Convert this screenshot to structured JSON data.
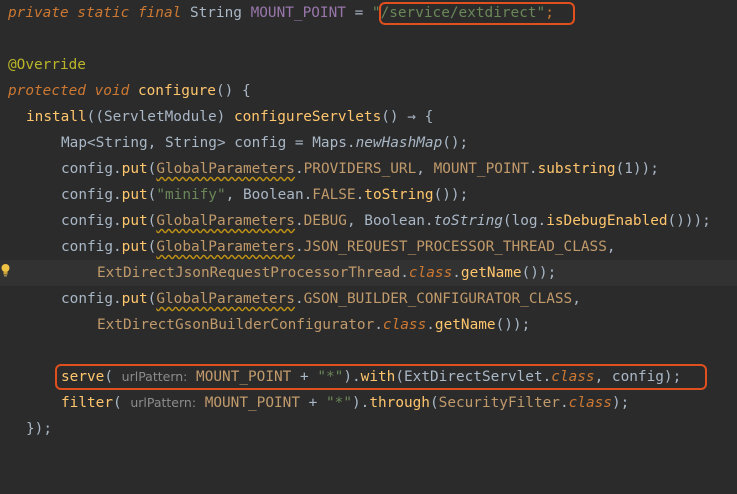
{
  "lines": [
    {
      "id": "l1",
      "tokens": [
        {
          "t": "private static final",
          "c": "kw"
        },
        {
          "t": " String ",
          "c": "type"
        },
        {
          "t": "MOUNT_POINT",
          "c": "const"
        },
        {
          "t": " = ",
          "c": "type"
        },
        {
          "t": "\"/service/extdirect\"",
          "c": "str"
        },
        {
          "t": ";",
          "c": "kwn"
        }
      ]
    },
    {
      "id": "l2",
      "tokens": []
    },
    {
      "id": "l3",
      "tokens": [
        {
          "t": "@Override",
          "c": "ann"
        }
      ]
    },
    {
      "id": "l4",
      "tokens": [
        {
          "t": "protected void",
          "c": "kw"
        },
        {
          "t": " ",
          "c": "type"
        },
        {
          "t": "configure",
          "c": "fn"
        },
        {
          "t": "() {",
          "c": "type"
        }
      ]
    },
    {
      "id": "l5",
      "tokens": [
        {
          "t": "install",
          "c": "fn"
        },
        {
          "t": "((ServletModule) ",
          "c": "type"
        },
        {
          "t": "configureServlets",
          "c": "fn"
        },
        {
          "t": "() → {",
          "c": "type"
        }
      ]
    },
    {
      "id": "l6",
      "tokens": [
        {
          "t": "Map",
          "c": "type"
        },
        {
          "t": "<String, String> config = Maps.",
          "c": "type"
        },
        {
          "t": "newHashMap",
          "c": "static"
        },
        {
          "t": "();",
          "c": "type"
        }
      ]
    },
    {
      "id": "l7",
      "tokens": [
        {
          "t": "config.",
          "c": "type"
        },
        {
          "t": "put",
          "c": "fn"
        },
        {
          "t": "(",
          "c": "type"
        },
        {
          "t": "GlobalParameters",
          "c": "warnc"
        },
        {
          "t": ".",
          "c": "type"
        },
        {
          "t": "PROVIDERS_URL",
          "c": "member"
        },
        {
          "t": ", ",
          "c": "type"
        },
        {
          "t": "MOUNT_POINT",
          "c": "member"
        },
        {
          "t": ".",
          "c": "type"
        },
        {
          "t": "substring",
          "c": "fn"
        },
        {
          "t": "(1));",
          "c": "type"
        }
      ]
    },
    {
      "id": "l8",
      "tokens": [
        {
          "t": "config.",
          "c": "type"
        },
        {
          "t": "put",
          "c": "fn"
        },
        {
          "t": "(",
          "c": "type"
        },
        {
          "t": "\"minify\"",
          "c": "str"
        },
        {
          "t": ", Boolean.",
          "c": "type"
        },
        {
          "t": "FALSE",
          "c": "member"
        },
        {
          "t": ".",
          "c": "type"
        },
        {
          "t": "toString",
          "c": "fn"
        },
        {
          "t": "());",
          "c": "type"
        }
      ]
    },
    {
      "id": "l9",
      "tokens": [
        {
          "t": "config.",
          "c": "type"
        },
        {
          "t": "put",
          "c": "fn"
        },
        {
          "t": "(",
          "c": "type"
        },
        {
          "t": "GlobalParameters",
          "c": "warnc"
        },
        {
          "t": ".",
          "c": "type"
        },
        {
          "t": "DEBUG",
          "c": "member"
        },
        {
          "t": ", Boolean.",
          "c": "type"
        },
        {
          "t": "toString",
          "c": "static"
        },
        {
          "t": "(log.",
          "c": "type"
        },
        {
          "t": "isDebugEnabled",
          "c": "fn"
        },
        {
          "t": "()));",
          "c": "type"
        }
      ]
    },
    {
      "id": "l10",
      "tokens": [
        {
          "t": "config.",
          "c": "type"
        },
        {
          "t": "put",
          "c": "fn"
        },
        {
          "t": "(",
          "c": "type"
        },
        {
          "t": "GlobalParameters",
          "c": "warnc"
        },
        {
          "t": ".",
          "c": "type"
        },
        {
          "t": "JSON_REQUEST_PROCESSOR_THREAD_CLASS",
          "c": "member"
        },
        {
          "t": ",",
          "c": "type"
        }
      ]
    },
    {
      "id": "l11",
      "tokens": [
        {
          "t": "ExtDirectJsonRequestProcessorThread",
          "c": "member"
        },
        {
          "t": ".",
          "c": "type"
        },
        {
          "t": "class",
          "c": "kw"
        },
        {
          "t": ".",
          "c": "type"
        },
        {
          "t": "getName",
          "c": "fn"
        },
        {
          "t": "());",
          "c": "type"
        }
      ]
    },
    {
      "id": "l12",
      "tokens": [
        {
          "t": "config.",
          "c": "type"
        },
        {
          "t": "put",
          "c": "fn"
        },
        {
          "t": "(",
          "c": "type"
        },
        {
          "t": "GlobalParameters",
          "c": "warnc"
        },
        {
          "t": ".",
          "c": "type"
        },
        {
          "t": "GSON_BUILDER_CONFIGURATOR_CLASS",
          "c": "member"
        },
        {
          "t": ",",
          "c": "type"
        }
      ]
    },
    {
      "id": "l13",
      "tokens": [
        {
          "t": "ExtDirectGsonBuilderConfigurator",
          "c": "member"
        },
        {
          "t": ".",
          "c": "type"
        },
        {
          "t": "class",
          "c": "kw"
        },
        {
          "t": ".",
          "c": "type"
        },
        {
          "t": "getName",
          "c": "fn"
        },
        {
          "t": "());",
          "c": "type"
        }
      ]
    },
    {
      "id": "l14",
      "tokens": []
    },
    {
      "id": "l15",
      "tokens": [
        {
          "t": "serve",
          "c": "fn"
        },
        {
          "t": "( ",
          "c": "type"
        },
        {
          "t": "urlPattern:",
          "c": "hint"
        },
        {
          "t": " MOUNT_POINT",
          "c": "member"
        },
        {
          "t": " + ",
          "c": "type"
        },
        {
          "t": "\"*\"",
          "c": "str"
        },
        {
          "t": ").",
          "c": "type"
        },
        {
          "t": "with",
          "c": "fn"
        },
        {
          "t": "(ExtDirectServlet.",
          "c": "type"
        },
        {
          "t": "class",
          "c": "kw"
        },
        {
          "t": ", config);",
          "c": "type"
        }
      ]
    },
    {
      "id": "l16",
      "tokens": [
        {
          "t": "filter",
          "c": "fn"
        },
        {
          "t": "( ",
          "c": "type"
        },
        {
          "t": "urlPattern:",
          "c": "hint"
        },
        {
          "t": " MOUNT_POINT",
          "c": "member"
        },
        {
          "t": " + ",
          "c": "type"
        },
        {
          "t": "\"*\"",
          "c": "str"
        },
        {
          "t": ").",
          "c": "type"
        },
        {
          "t": "through",
          "c": "fn"
        },
        {
          "t": "(",
          "c": "type"
        },
        {
          "t": "SecurityFilter",
          "c": "member"
        },
        {
          "t": ".",
          "c": "type"
        },
        {
          "t": "class",
          "c": "kw"
        },
        {
          "t": ");",
          "c": "type"
        }
      ]
    },
    {
      "id": "l17",
      "tokens": [
        {
          "t": "});",
          "c": "type"
        }
      ]
    }
  ],
  "colors": {
    "background": "#2b2b2b",
    "highlight_box": "#e0501f"
  },
  "icons": {
    "gutter": "lightbulb-icon"
  }
}
